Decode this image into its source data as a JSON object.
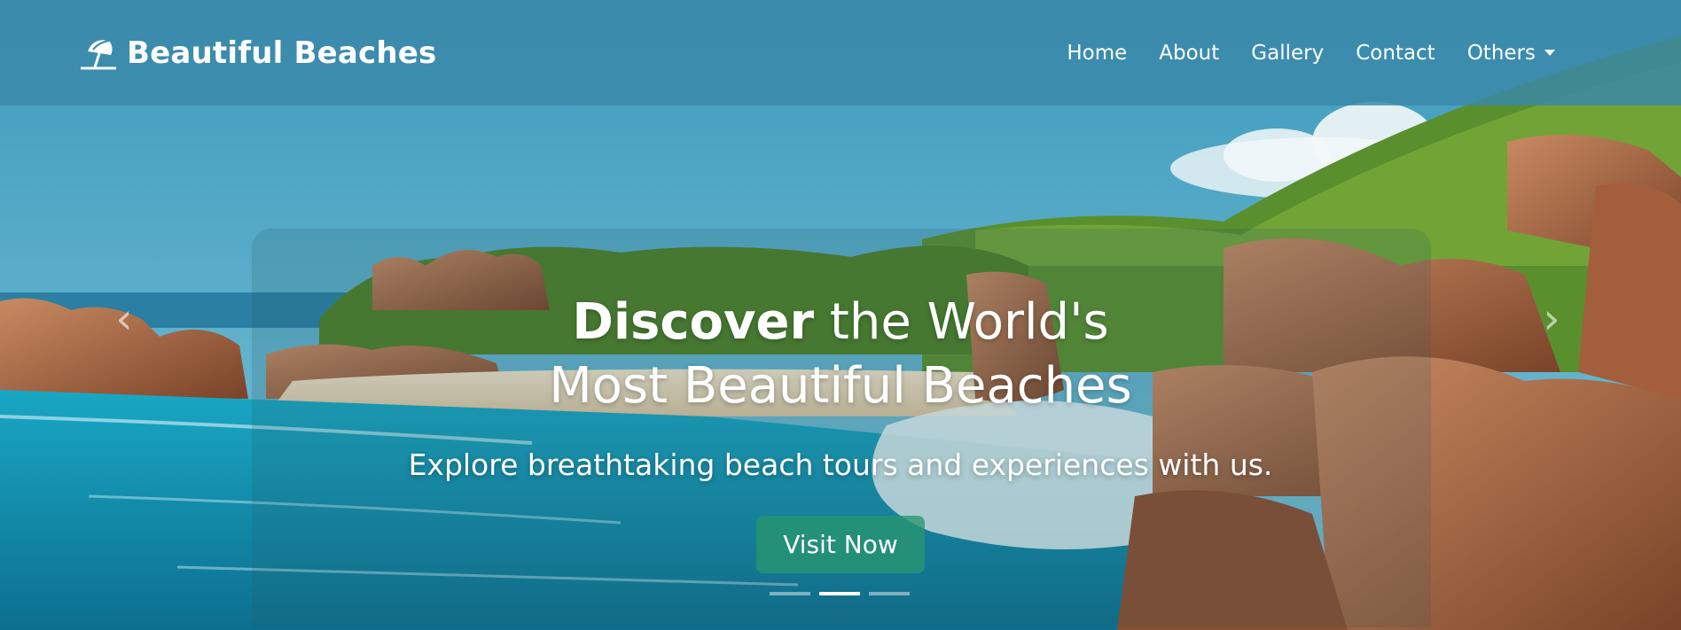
{
  "brand": {
    "name": "Beautiful Beaches",
    "icon": "beach-umbrella-icon"
  },
  "nav": {
    "items": [
      {
        "label": "Home"
      },
      {
        "label": "About"
      },
      {
        "label": "Gallery"
      },
      {
        "label": "Contact"
      },
      {
        "label": "Others",
        "icon": "caret-down-icon"
      }
    ]
  },
  "hero": {
    "headline_bold": "Discover",
    "headline_rest1": " the World's",
    "headline_line2": "Most Beautiful Beaches",
    "subtitle": "Explore breathtaking beach tours and experiences with us.",
    "cta_label": "Visit Now",
    "prev_icon": "chevron-left-icon",
    "next_icon": "chevron-right-icon",
    "slides": {
      "count": 3,
      "active": 2
    }
  },
  "colors": {
    "navbar": "#3988a8",
    "cta": "#2b9a70",
    "sky": "#5fb3cf",
    "sea": "#1f9fbf",
    "rock": "#b86f4a"
  }
}
